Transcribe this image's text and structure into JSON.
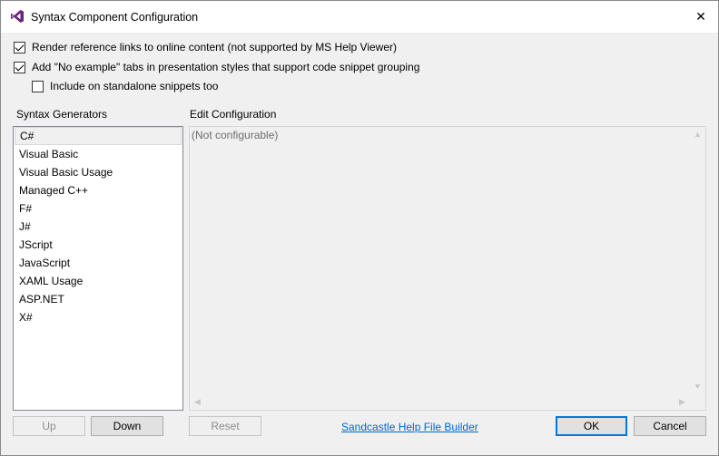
{
  "window": {
    "title": "Syntax Component Configuration",
    "close_glyph": "✕",
    "accent_color": "#0078d7",
    "icon_color": "#68217a"
  },
  "options": [
    {
      "label": "Render reference links to online content (not supported by MS Help Viewer)",
      "checked": true
    },
    {
      "label": "Add \"No example\" tabs in presentation styles that support code snippet grouping",
      "checked": true
    },
    {
      "label": "Include on standalone snippets too",
      "checked": false
    }
  ],
  "generators": {
    "label": "Syntax Generators",
    "items": [
      "C#",
      "Visual Basic",
      "Visual Basic Usage",
      "Managed C++",
      "F#",
      "J#",
      "JScript",
      "JavaScript",
      "XAML Usage",
      "ASP.NET",
      "X#"
    ],
    "selected": "C#"
  },
  "edit": {
    "label": "Edit Configuration",
    "text": "(Not configurable)"
  },
  "buttons": {
    "up": "Up",
    "down": "Down",
    "reset": "Reset",
    "ok": "OK",
    "cancel": "Cancel"
  },
  "link": {
    "text": "Sandcastle Help File Builder"
  }
}
